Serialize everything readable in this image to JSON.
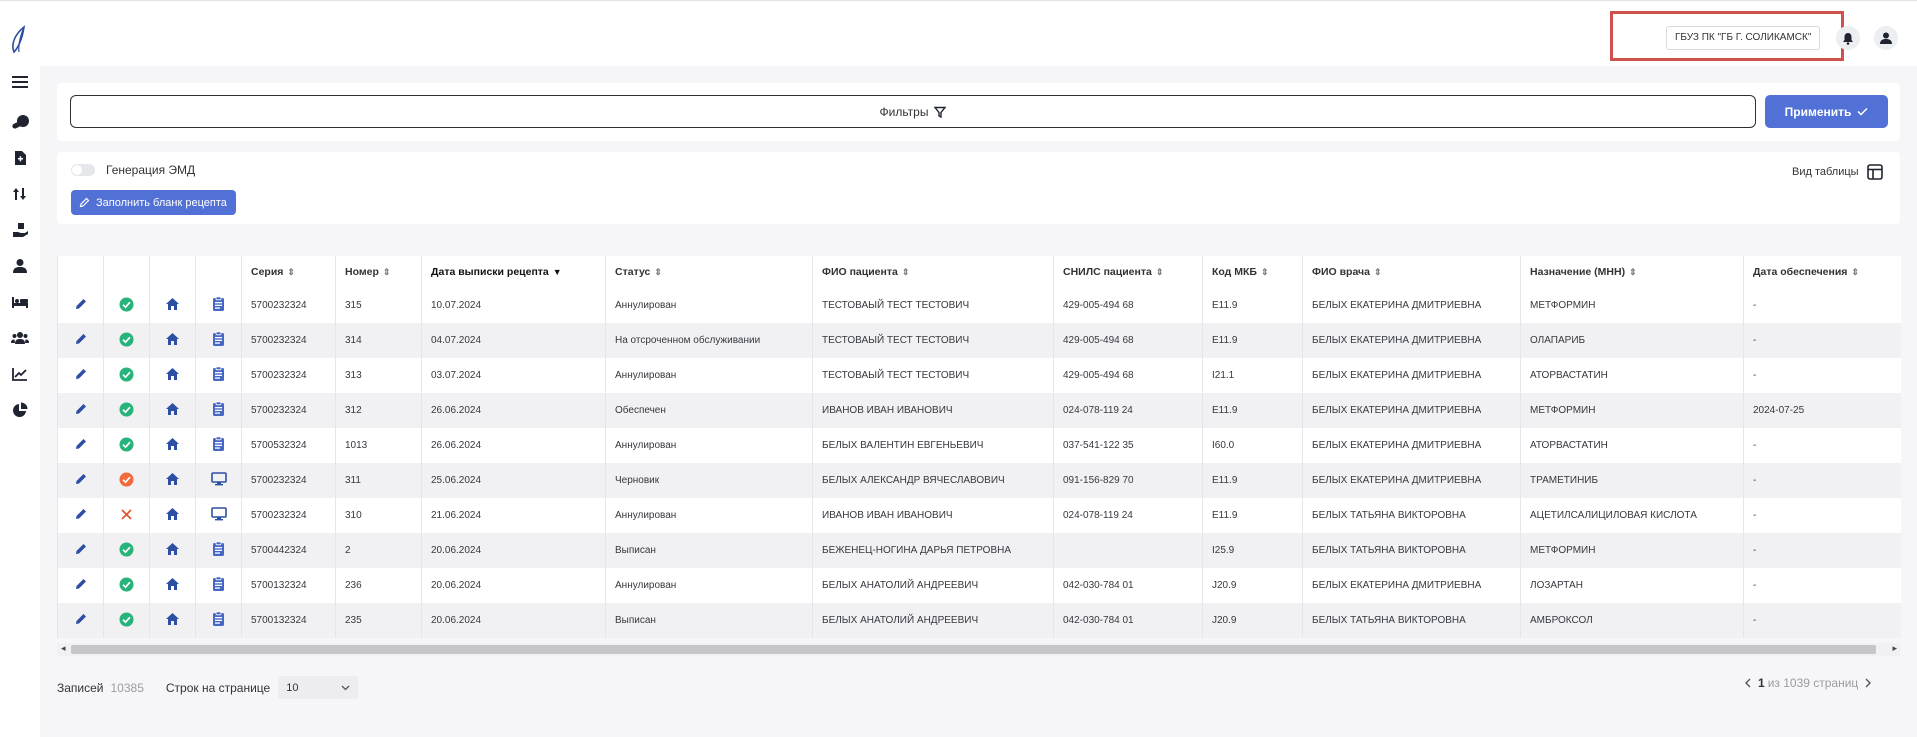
{
  "header": {
    "org_name": "ГБУЗ ПК \"ГБ Г. СОЛИКАМСК\""
  },
  "sidebar": {
    "items": [
      {
        "icon": "menu-icon"
      },
      {
        "icon": "pills-icon"
      },
      {
        "icon": "prescription-file-icon"
      },
      {
        "icon": "sort-arrows-icon"
      },
      {
        "icon": "hand-box-icon"
      },
      {
        "icon": "user-doctor-icon"
      },
      {
        "icon": "bed-icon"
      },
      {
        "icon": "users-icon"
      },
      {
        "icon": "chart-line-icon"
      },
      {
        "icon": "pie-chart-icon"
      }
    ]
  },
  "filters": {
    "label": "Фильтры",
    "apply_label": "Применить"
  },
  "toolbar": {
    "emd_label": "Генерация ЭМД",
    "fill_label": "Заполнить бланк рецепта",
    "view_label": "Вид таблицы"
  },
  "table": {
    "columns": [
      "Серия",
      "Номер",
      "Дата выписки рецепта",
      "Статус",
      "ФИО пациента",
      "СНИЛС пациента",
      "Код МКБ",
      "ФИО врача",
      "Назначение (МНН)",
      "Дата обеспечения"
    ],
    "rows": [
      {
        "status_icon": "check",
        "doc_icon": "clipboard",
        "series": "5700232324",
        "number": "315",
        "date": "10.07.2024",
        "status": "Аннулирован",
        "patient": "ТЕСТОВАЫЙ ТЕСТ ТЕСТОВИЧ",
        "snils": "429-005-494 68",
        "mkb": "E11.9",
        "doctor": "БЕЛЫХ ЕКАТЕРИНА ДМИТРИЕВНА",
        "drug": "МЕТФОРМИН",
        "supply_date": "-"
      },
      {
        "status_icon": "check",
        "doc_icon": "clipboard",
        "series": "5700232324",
        "number": "314",
        "date": "04.07.2024",
        "status": "На отсроченном обслуживании",
        "patient": "ТЕСТОВАЫЙ ТЕСТ ТЕСТОВИЧ",
        "snils": "429-005-494 68",
        "mkb": "E11.9",
        "doctor": "БЕЛЫХ ЕКАТЕРИНА ДМИТРИЕВНА",
        "drug": "ОЛАПАРИБ",
        "supply_date": "-"
      },
      {
        "status_icon": "check",
        "doc_icon": "clipboard",
        "series": "5700232324",
        "number": "313",
        "date": "03.07.2024",
        "status": "Аннулирован",
        "patient": "ТЕСТОВАЫЙ ТЕСТ ТЕСТОВИЧ",
        "snils": "429-005-494 68",
        "mkb": "I21.1",
        "doctor": "БЕЛЫХ ЕКАТЕРИНА ДМИТРИЕВНА",
        "drug": "АТОРВАСТАТИН",
        "supply_date": "-"
      },
      {
        "status_icon": "check",
        "doc_icon": "clipboard",
        "series": "5700232324",
        "number": "312",
        "date": "26.06.2024",
        "status": "Обеспечен",
        "patient": "ИВАНОВ ИВАН ИВАНОВИЧ",
        "snils": "024-078-119 24",
        "mkb": "E11.9",
        "doctor": "БЕЛЫХ ЕКАТЕРИНА ДМИТРИЕВНА",
        "drug": "МЕТФОРМИН",
        "supply_date": "2024-07-25"
      },
      {
        "status_icon": "check",
        "doc_icon": "clipboard",
        "series": "5700532324",
        "number": "1013",
        "date": "26.06.2024",
        "status": "Аннулирован",
        "patient": "БЕЛЫХ ВАЛЕНТИН ЕВГЕНЬЕВИЧ",
        "snils": "037-541-122 35",
        "mkb": "I60.0",
        "doctor": "БЕЛЫХ ЕКАТЕРИНА ДМИТРИЕВНА",
        "drug": "АТОРВАСТАТИН",
        "supply_date": "-"
      },
      {
        "status_icon": "check-red",
        "doc_icon": "monitor",
        "series": "5700232324",
        "number": "311",
        "date": "25.06.2024",
        "status": "Черновик",
        "patient": "БЕЛЫХ АЛЕКСАНДР ВЯЧЕСЛАВОВИЧ",
        "snils": "091-156-829 70",
        "mkb": "E11.9",
        "doctor": "БЕЛЫХ ЕКАТЕРИНА ДМИТРИЕВНА",
        "drug": "ТРАМЕТИНИБ",
        "supply_date": "-"
      },
      {
        "status_icon": "cross",
        "doc_icon": "monitor",
        "series": "5700232324",
        "number": "310",
        "date": "21.06.2024",
        "status": "Аннулирован",
        "patient": "ИВАНОВ ИВАН ИВАНОВИЧ",
        "snils": "024-078-119 24",
        "mkb": "E11.9",
        "doctor": "БЕЛЫХ ТАТЬЯНА ВИКТОРОВНА",
        "drug": "АЦЕТИЛСАЛИЦИЛОВАЯ КИСЛОТА",
        "supply_date": "-"
      },
      {
        "status_icon": "check",
        "doc_icon": "clipboard",
        "series": "5700442324",
        "number": "2",
        "date": "20.06.2024",
        "status": "Выписан",
        "patient": "БЕЖЕНЕЦ-НОГИНА ДАРЬЯ ПЕТРОВНА",
        "snils": "",
        "mkb": "I25.9",
        "doctor": "БЕЛЫХ ТАТЬЯНА ВИКТОРОВНА",
        "drug": "МЕТФОРМИН",
        "supply_date": "-"
      },
      {
        "status_icon": "check",
        "doc_icon": "clipboard",
        "series": "5700132324",
        "number": "236",
        "date": "20.06.2024",
        "status": "Аннулирован",
        "patient": "БЕЛЫХ АНАТОЛИЙ АНДРЕЕВИЧ",
        "snils": "042-030-784 01",
        "mkb": "J20.9",
        "doctor": "БЕЛЫХ ЕКАТЕРИНА ДМИТРИЕВНА",
        "drug": "ЛОЗАРТАН",
        "supply_date": "-"
      },
      {
        "status_icon": "check",
        "doc_icon": "clipboard",
        "series": "5700132324",
        "number": "235",
        "date": "20.06.2024",
        "status": "Выписан",
        "patient": "БЕЛЫХ АНАТОЛИЙ АНДРЕЕВИЧ",
        "snils": "042-030-784 01",
        "mkb": "J20.9",
        "doctor": "БЕЛЫХ ТАТЬЯНА ВИКТОРОВНА",
        "drug": "АМБРОКСОЛ",
        "supply_date": "-"
      }
    ]
  },
  "footer": {
    "records_label": "Записей",
    "records_count": "10385",
    "rows_per_page_label": "Строк на странице",
    "rows_per_page_value": "10",
    "current_page": "1",
    "of_pages": "из 1039 страниц"
  },
  "colors": {
    "accent": "#5271d6",
    "success": "#27b37a",
    "warning": "#f06a3b",
    "danger": "#e0552f",
    "highlight": "#d0504b"
  }
}
